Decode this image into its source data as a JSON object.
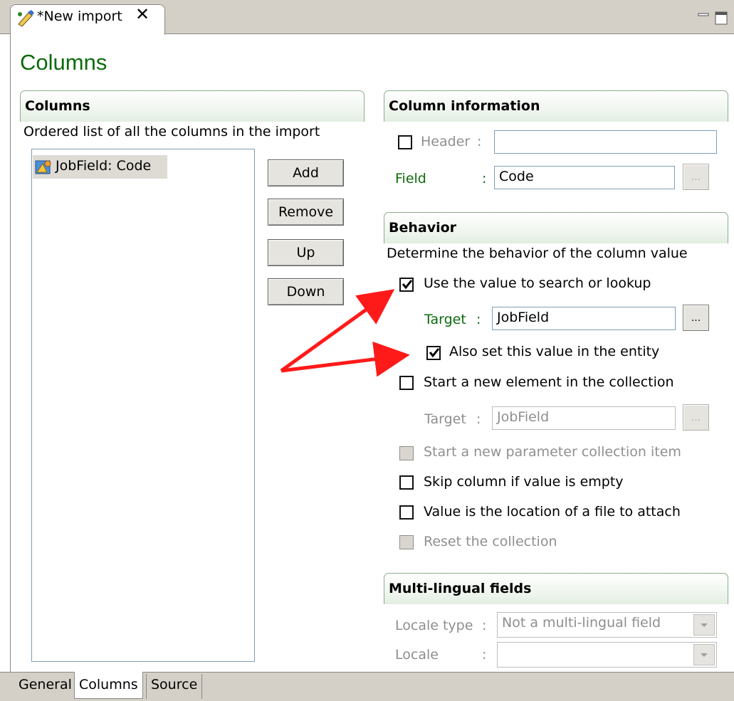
{
  "editor_tab": {
    "title": "*New import"
  },
  "page": {
    "title": "Columns"
  },
  "columns_section": {
    "title": "Columns",
    "description": "Ordered list of all the columns in the import",
    "items": [
      {
        "label": "JobField: Code"
      }
    ],
    "buttons": {
      "add": "Add",
      "remove": "Remove",
      "up": "Up",
      "down": "Down"
    }
  },
  "column_info": {
    "title": "Column information",
    "header_label": "Header",
    "header_value": "",
    "field_label": "Field",
    "field_value": "Code",
    "colon": ":",
    "ellipsis": "..."
  },
  "behavior": {
    "title": "Behavior",
    "description": "Determine the behavior of the column value",
    "use_value": "Use the value to search or lookup",
    "target_label": "Target",
    "target_value": "JobField",
    "also_set": "Also set this value in the entity",
    "start_new_element": "Start a new element in the collection",
    "target2_label": "Target",
    "target2_value": "JobField",
    "start_param": "Start a new parameter collection item",
    "skip_empty": "Skip column if value is empty",
    "file_attach": "Value is the location of a file to attach",
    "reset_collection": "Reset the collection"
  },
  "multilingual": {
    "title": "Multi-lingual fields",
    "locale_type_label": "Locale type",
    "locale_type_value": "Not a multi-lingual field",
    "locale_label": "Locale",
    "locale_value": ""
  },
  "bottom_tabs": [
    "General",
    "Columns",
    "Source"
  ],
  "colors": {
    "accent_green": "#0b6b0b",
    "arrow_red": "#ff1a1a"
  }
}
